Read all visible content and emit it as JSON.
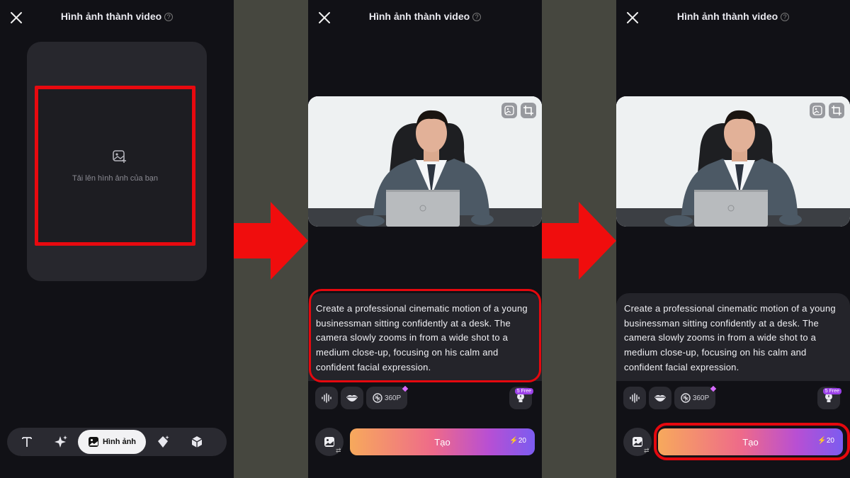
{
  "screen": {
    "title": "Hình ảnh thành video",
    "help_glyph": "?"
  },
  "upload": {
    "label": "Tải lên hình ảnh của bạn"
  },
  "bottom_nav": {
    "image_tab_label": "Hình ảnh",
    "items": [
      "text-icon",
      "sparkle-icon",
      "image-icon",
      "magic-icon",
      "cube-icon"
    ]
  },
  "photo": {
    "subject": "young businessman at desk with laptop"
  },
  "prompt": {
    "text": "Create a professional cinematic motion of a young businessman sitting confidently at a desk. The camera slowly zooms in from a wide shot to a medium close-up, focusing on his calm and confident facial expression."
  },
  "tools": {
    "resolution": "360P",
    "free_badge": "5 Free"
  },
  "create": {
    "label": "Tạo",
    "cost": "20"
  },
  "colors": {
    "highlight": "#e5080e",
    "gradient_start": "#f7a95c",
    "gradient_end": "#7c5cf0",
    "panel_bg": "#111116"
  }
}
